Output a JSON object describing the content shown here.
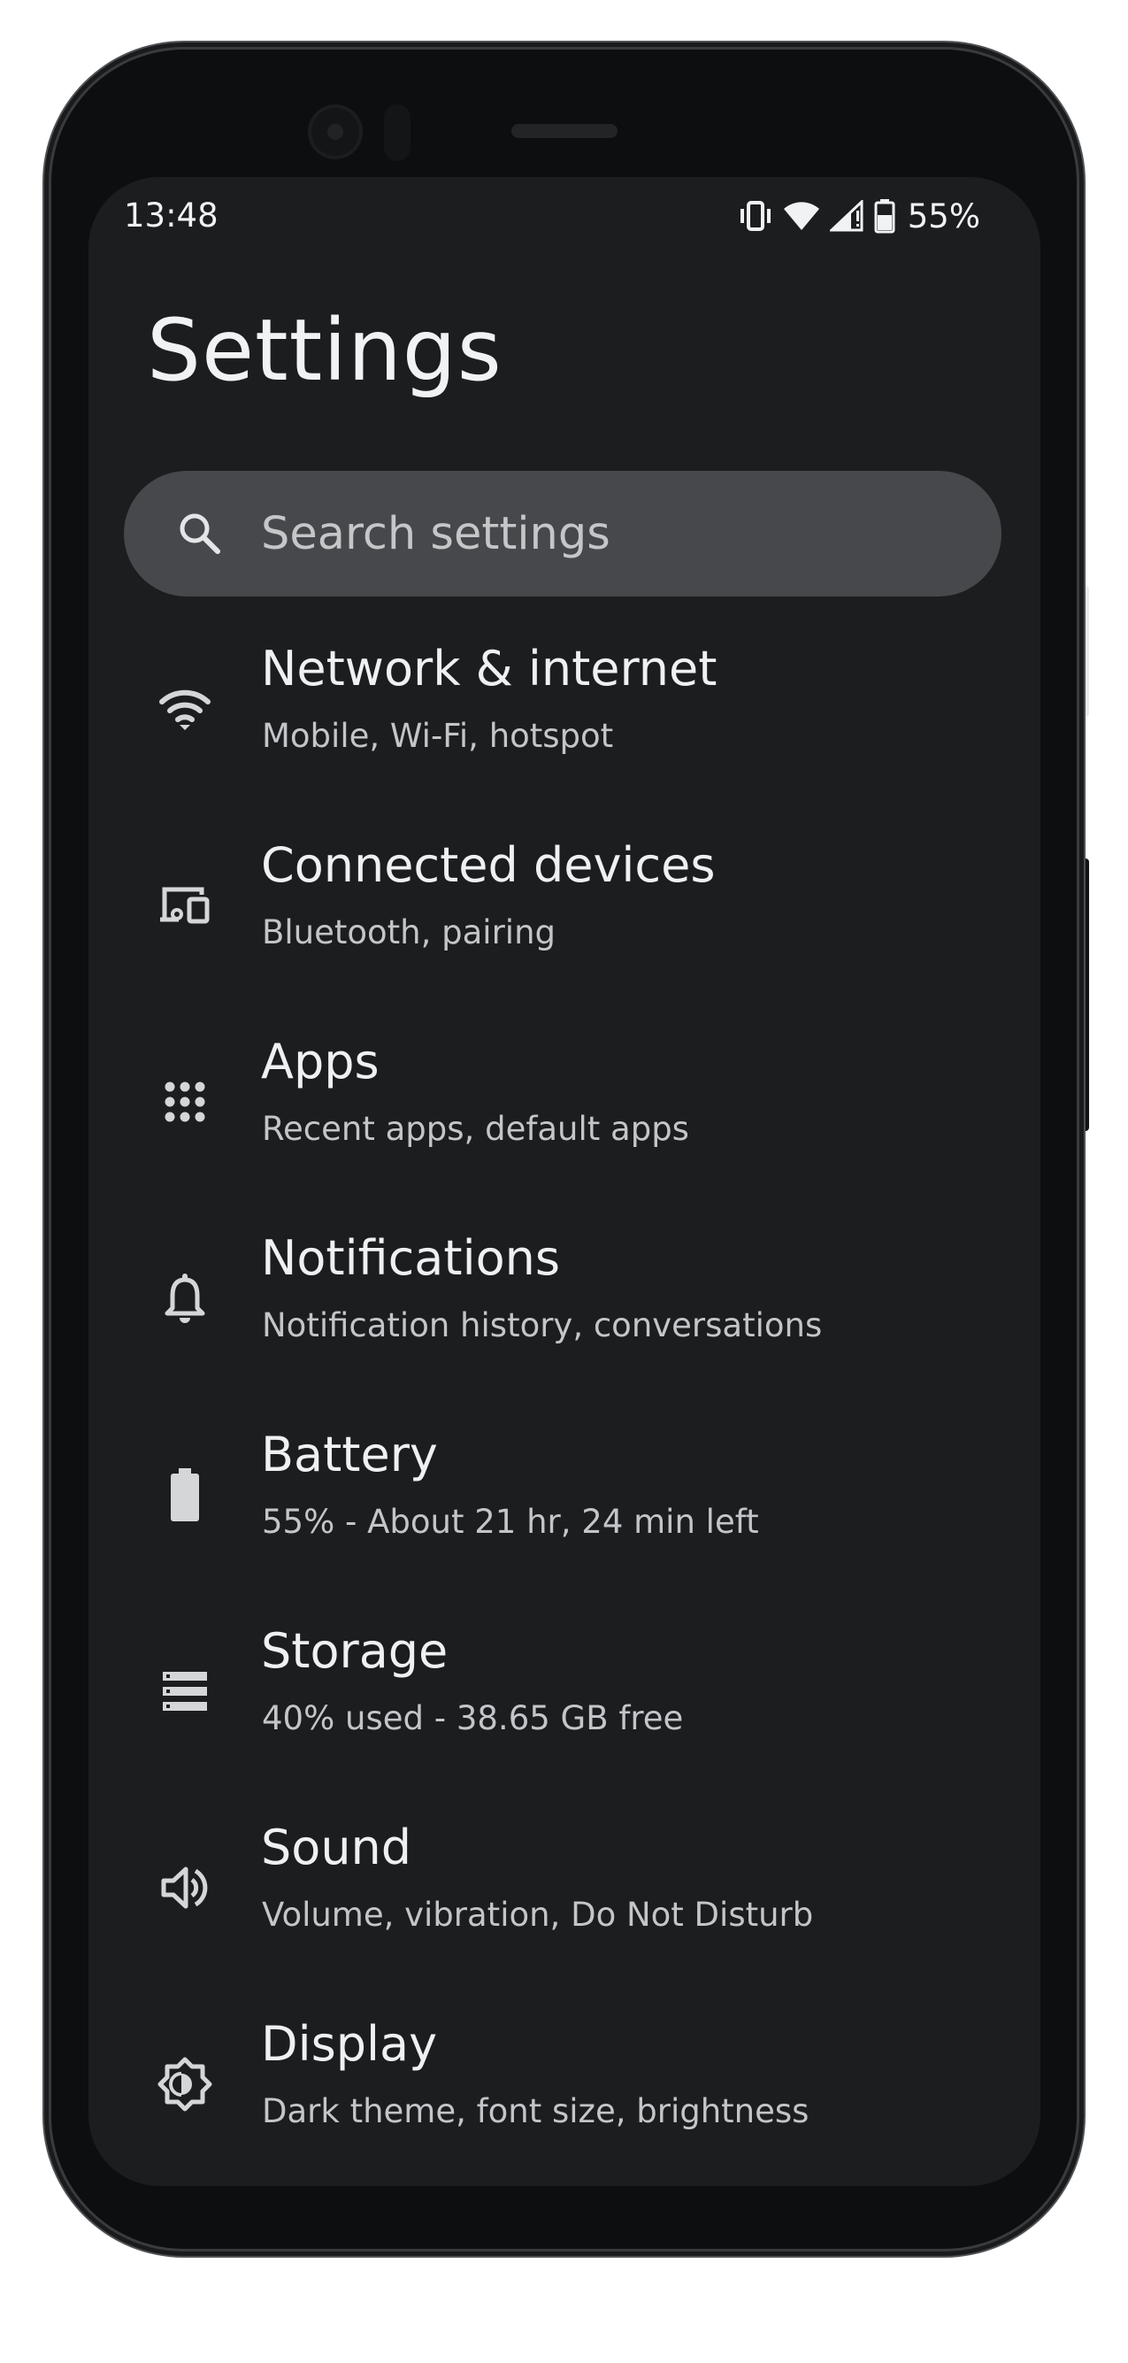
{
  "status_bar": {
    "time": "13:48",
    "battery_percent": "55%",
    "icons": [
      "vibrate-icon",
      "wifi-icon",
      "signal-icon",
      "battery-icon"
    ]
  },
  "page": {
    "title": "Settings"
  },
  "search": {
    "placeholder": "Search settings",
    "icon": "search-icon"
  },
  "settings_items": [
    {
      "title": "Network & internet",
      "subtitle": "Mobile, Wi-Fi, hotspot",
      "icon": "wifi-icon"
    },
    {
      "title": "Connected devices",
      "subtitle": "Bluetooth, pairing",
      "icon": "devices-icon"
    },
    {
      "title": "Apps",
      "subtitle": "Recent apps, default apps",
      "icon": "apps-grid-icon"
    },
    {
      "title": "Notifications",
      "subtitle": "Notification history, conversations",
      "icon": "bell-icon"
    },
    {
      "title": "Battery",
      "subtitle": "55% - About 21 hr, 24 min left",
      "icon": "battery-icon"
    },
    {
      "title": "Storage",
      "subtitle": "40% used - 38.65 GB free",
      "icon": "storage-icon"
    },
    {
      "title": "Sound",
      "subtitle": "Volume, vibration, Do Not Disturb",
      "icon": "speaker-icon"
    },
    {
      "title": "Display",
      "subtitle": "Dark theme, font size, brightness",
      "icon": "brightness-icon"
    }
  ],
  "colors": {
    "screen_background": "#1b1d1f",
    "search_background": "#47484b",
    "text_primary": "#eef0f2",
    "text_secondary": "#c3c5c8",
    "icon": "#d4d6d8"
  }
}
